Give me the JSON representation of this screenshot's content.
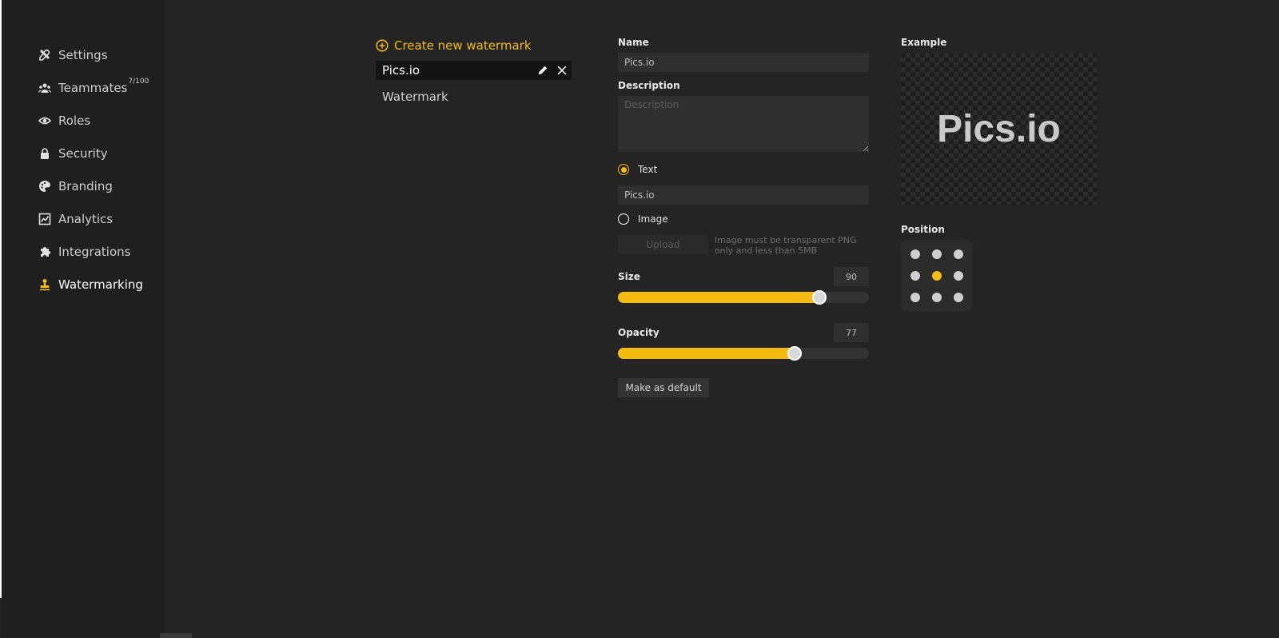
{
  "sidebar": {
    "items": [
      {
        "label": "Settings",
        "icon": "tools-icon"
      },
      {
        "label": "Teammates",
        "icon": "users-icon",
        "badge": "7/100"
      },
      {
        "label": "Roles",
        "icon": "eye-icon"
      },
      {
        "label": "Security",
        "icon": "lock-icon"
      },
      {
        "label": "Branding",
        "icon": "palette-icon"
      },
      {
        "label": "Analytics",
        "icon": "chart-icon"
      },
      {
        "label": "Integrations",
        "icon": "puzzle-icon"
      },
      {
        "label": "Watermarking",
        "icon": "stamp-icon",
        "active": true
      }
    ]
  },
  "watermarks": {
    "create_label": "Create new watermark",
    "items": [
      {
        "label": "Pics.io",
        "selected": true
      },
      {
        "label": "Watermark",
        "selected": false
      }
    ]
  },
  "form": {
    "name_label": "Name",
    "name_value": "Pics.io",
    "description_label": "Description",
    "description_placeholder": "Description",
    "text_option_label": "Text",
    "text_value": "Pics.io",
    "image_option_label": "Image",
    "upload_label": "Upload",
    "upload_hint": "Image must be transparent PNG only and less than 5MB",
    "size_label": "Size",
    "size_value": "90",
    "size_percent": 90,
    "opacity_label": "Opacity",
    "opacity_value": "77",
    "opacity_percent": 77,
    "default_button_label": "Make as default"
  },
  "example": {
    "label": "Example",
    "preview_text": "Pics.io",
    "position_label": "Position",
    "selected_position": "center"
  },
  "colors": {
    "accent": "#f5bb10",
    "background": "#242424",
    "sidebar": "#1f1f1f"
  }
}
